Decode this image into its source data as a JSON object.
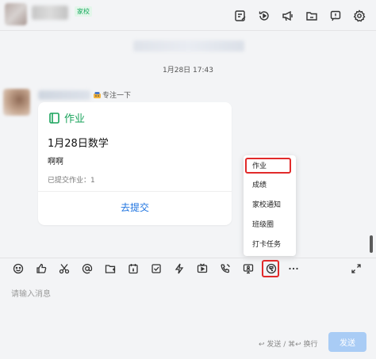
{
  "header": {
    "tag": "家校",
    "icons": [
      "edit-note-icon",
      "history-icon",
      "megaphone-icon",
      "folder-icon",
      "flag-icon",
      "gear-icon"
    ]
  },
  "messages": {
    "timestamp": "1月28日 17:43",
    "sender_status": "专注一下",
    "card": {
      "type_label": "作业",
      "title": "1月28日数学",
      "description": "啊啊",
      "meta": "已提交作业：1",
      "action": "去提交"
    }
  },
  "popup_menu": {
    "items": [
      "作业",
      "成绩",
      "家校通知",
      "班级圈",
      "打卡任务"
    ]
  },
  "toolbar": {
    "icons": [
      "emoji-icon",
      "thumbs-up-icon",
      "scissors-icon",
      "at-icon",
      "folder-add-icon",
      "calendar-icon",
      "checkbox-icon",
      "lightning-icon",
      "video-icon",
      "phone-icon",
      "screen-share-icon",
      "school-app-icon",
      "more-icon"
    ]
  },
  "composer": {
    "placeholder": "请输入消息",
    "send_hint": "↩ 发送 / ⌘↩ 换行",
    "send_label": "发送"
  },
  "colors": {
    "accent_green": "#19a35b",
    "link_blue": "#1d73e0",
    "highlight_red": "#e12a2a",
    "send_button": "#a9ccf5"
  }
}
